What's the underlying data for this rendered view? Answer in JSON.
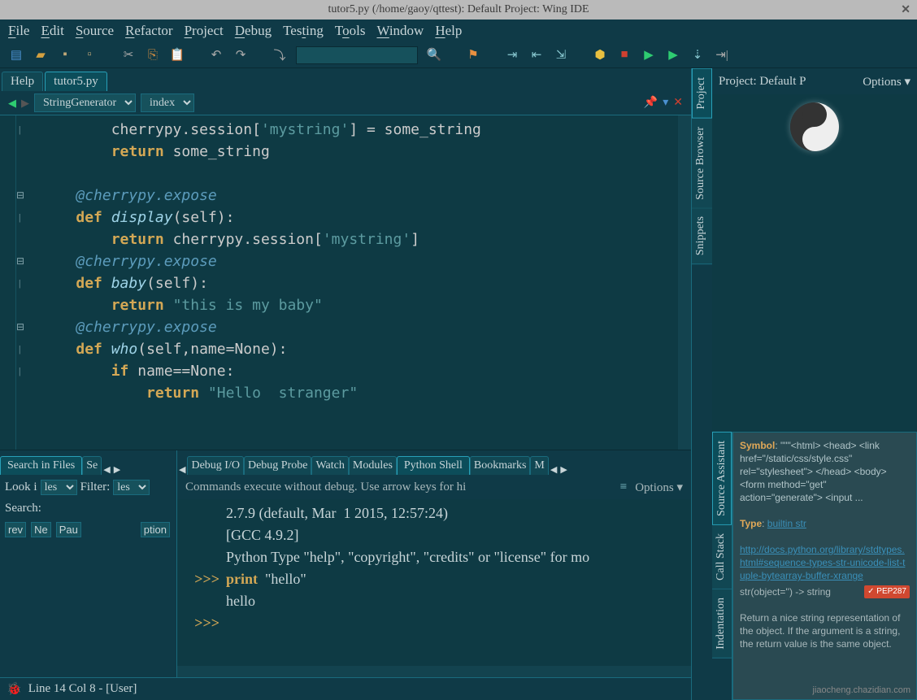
{
  "title": "tutor5.py (/home/gaoy/qttest): Default Project: Wing IDE",
  "menu": {
    "file": "File",
    "edit": "Edit",
    "source": "Source",
    "refactor": "Refactor",
    "project": "Project",
    "debug": "Debug",
    "testing": "Testing",
    "tools": "Tools",
    "window": "Window",
    "help": "Help"
  },
  "file_tabs": {
    "help": "Help",
    "tutor": "tutor5.py"
  },
  "editor_nav": {
    "symbol": "StringGenerator",
    "member": "index"
  },
  "code": {
    "l1": "        cherrypy.session['mystring'] = some_string",
    "l2": "        return some_string",
    "l3": "",
    "l4": "    @cherrypy.expose",
    "l5": "    def display(self):",
    "l6": "        return cherrypy.session['mystring']",
    "l7": "    @cherrypy.expose",
    "l8": "    def baby(self):",
    "l9": "        return \"this is my baby\"",
    "l10": "    @cherrypy.expose",
    "l11": "    def who(self,name=None):",
    "l12": "        if name==None:",
    "l13": "            return \"Hello  stranger\""
  },
  "search_panel": {
    "tab1": "Search in Files",
    "tab2": "Se",
    "look": "Look i",
    "look_sel": "les",
    "filter": "Filter:",
    "filter_sel": "les",
    "search": "Search:",
    "btns": {
      "prev": "rev",
      "next": "Ne",
      "pause": "Pau",
      "options": "ption"
    }
  },
  "shell_tabs": {
    "t1": "Debug I/O",
    "t2": "Debug Probe",
    "t3": "Watch",
    "t4": "Modules",
    "t5": "Python Shell",
    "t6": "Bookmarks",
    "t7": "M"
  },
  "shell": {
    "hint": "Commands execute without debug.  Use arrow keys for hi",
    "options": "Options",
    "l1": "2.7.9 (default, Mar  1 2015, 12:57:24)",
    "l2": "[GCC 4.9.2]",
    "l3": "Python Type \"help\", \"copyright\", \"credits\" or \"license\" for mo",
    "l4_prompt": ">>>",
    "l4_kw": "print",
    "l4_rest": "  \"hello\"",
    "l5": "hello",
    "l6_prompt": ">>>"
  },
  "right": {
    "project": "Project: Default P",
    "options": "Options",
    "vtabs": {
      "proj": "Project",
      "browser": "Source Browser",
      "snip": "Snippets",
      "assist": "Source Assistant",
      "call": "Call Stack",
      "indent": "Indentation"
    },
    "assist": {
      "symbol_k": "Symbol",
      "symbol_v": ": \"\"\"<html> <head> <link href=\"/static/css/style.css\" rel=\"stylesheet\"> </head> <body> <form method=\"get\" action=\"generate\"> <input ...",
      "type_k": "Type",
      "type_v": "builtin str",
      "link": "http://docs.python.org/library/stdtypes.html#sequence-types-str-unicode-list-tuple-bytearray-buffer-xrange",
      "sig": "str(object='') -> string",
      "badge": "✓ PEP287",
      "doc": "Return a nice string representation of the object. If the argument is a string, the return value is the same object."
    }
  },
  "status": {
    "pos": "Line 14 Col 8 - [User]"
  },
  "watermark": "jiaocheng.chazidian.com"
}
